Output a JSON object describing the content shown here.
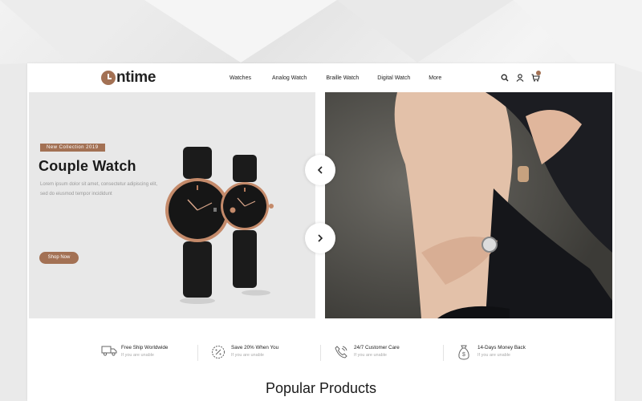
{
  "brand": {
    "logo_text": "ntime",
    "logo_letter": "O",
    "accent": "#a37154"
  },
  "nav": {
    "items": [
      "Watches",
      "Analog Watch",
      "Braille Watch",
      "Digital Watch",
      "More"
    ]
  },
  "header_icons": [
    "search-icon",
    "user-icon",
    "cart-icon"
  ],
  "hero": {
    "tag": "New Collection 2019",
    "title": "Couple Watch",
    "text": "Lorem ipsum dolor sit amet, consectetur adipiscing elit, sed do eiusmod tempor incididunt",
    "button": "Shop Now",
    "prev_icon": "chevron-left-icon",
    "next_icon": "chevron-right-icon"
  },
  "features": [
    {
      "title": "Free Ship Worldwide",
      "sub": "If you are unable",
      "icon": "truck-icon"
    },
    {
      "title": "Save 20% When You",
      "sub": "If you are unable",
      "icon": "discount-icon"
    },
    {
      "title": "24/7 Customer Care",
      "sub": "If you are unable",
      "icon": "phone-icon"
    },
    {
      "title": "14-Days Money Back",
      "sub": "If you are unable",
      "icon": "money-bag-icon"
    }
  ],
  "section": {
    "title": "Popular Products"
  }
}
